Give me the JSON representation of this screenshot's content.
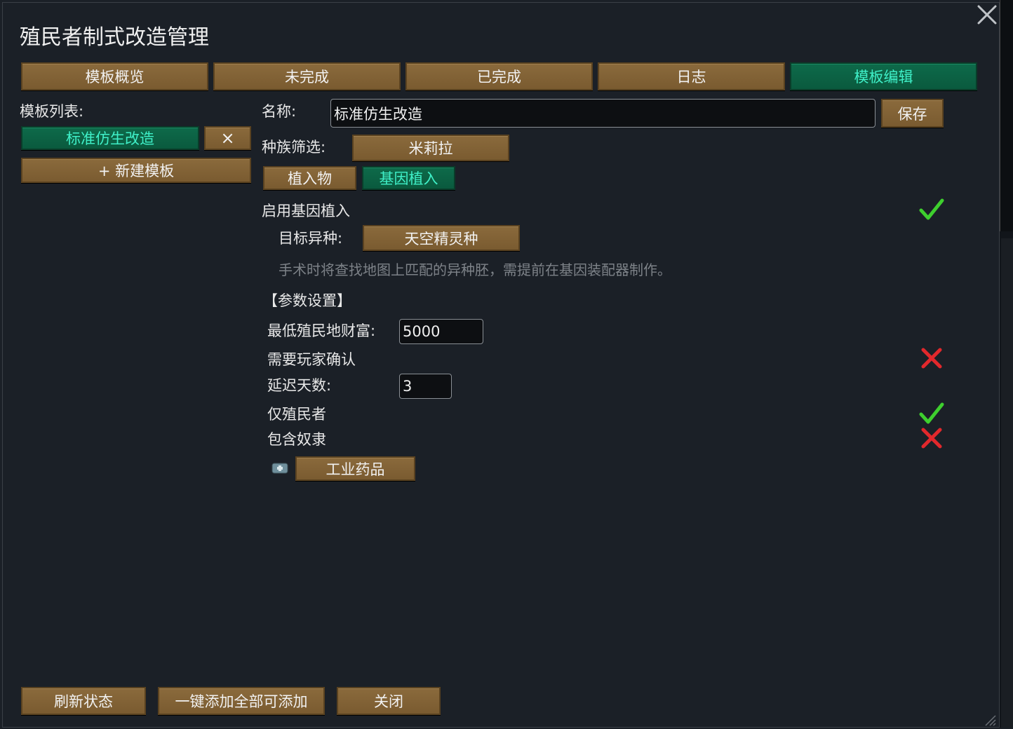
{
  "window": {
    "title": "殖民者制式改造管理"
  },
  "tabs": [
    {
      "label": "模板概览"
    },
    {
      "label": "未完成"
    },
    {
      "label": "已完成"
    },
    {
      "label": "日志"
    },
    {
      "label": "模板编辑"
    }
  ],
  "sidebar": {
    "list_label": "模板列表:",
    "template_item": "标准仿生改造",
    "delete_label": "×",
    "new_template": "+ 新建模板"
  },
  "editor": {
    "name_label": "名称:",
    "name_value": "标准仿生改造",
    "save_label": "保存",
    "race_filter_label": "种族筛选:",
    "race_value": "米莉拉",
    "subtabs": [
      {
        "label": "植入物"
      },
      {
        "label": "基因植入"
      }
    ],
    "enable_gene_label": "启用基因植入",
    "enable_gene_value": true,
    "target_xenotype_label": "目标异种:",
    "target_xenotype_value": "天空精灵种",
    "hint": "手术时将查找地图上匹配的异种胚，需提前在基因装配器制作。",
    "params_header": "【参数设置】",
    "min_wealth_label": "最低殖民地财富:",
    "min_wealth_value": "5000",
    "need_confirm_label": "需要玩家确认",
    "need_confirm_value": false,
    "delay_label": "延迟天数:",
    "delay_value": "3",
    "colonists_only_label": "仅殖民者",
    "colonists_only_value": true,
    "include_slaves_label": "包含奴隶",
    "include_slaves_value": false,
    "medicine_icon": "industrial-medicine-icon",
    "medicine_label": "工业药品"
  },
  "footer": {
    "refresh_label": "刷新状态",
    "add_all_label": "一键添加全部可添加",
    "close_label": "关闭"
  },
  "colors": {
    "button_brown": "#7a5b30",
    "active_green": "#0a5a3e",
    "active_text": "#3ff0c8",
    "check_green": "#3ecf2e",
    "cross_red": "#e2282c"
  }
}
